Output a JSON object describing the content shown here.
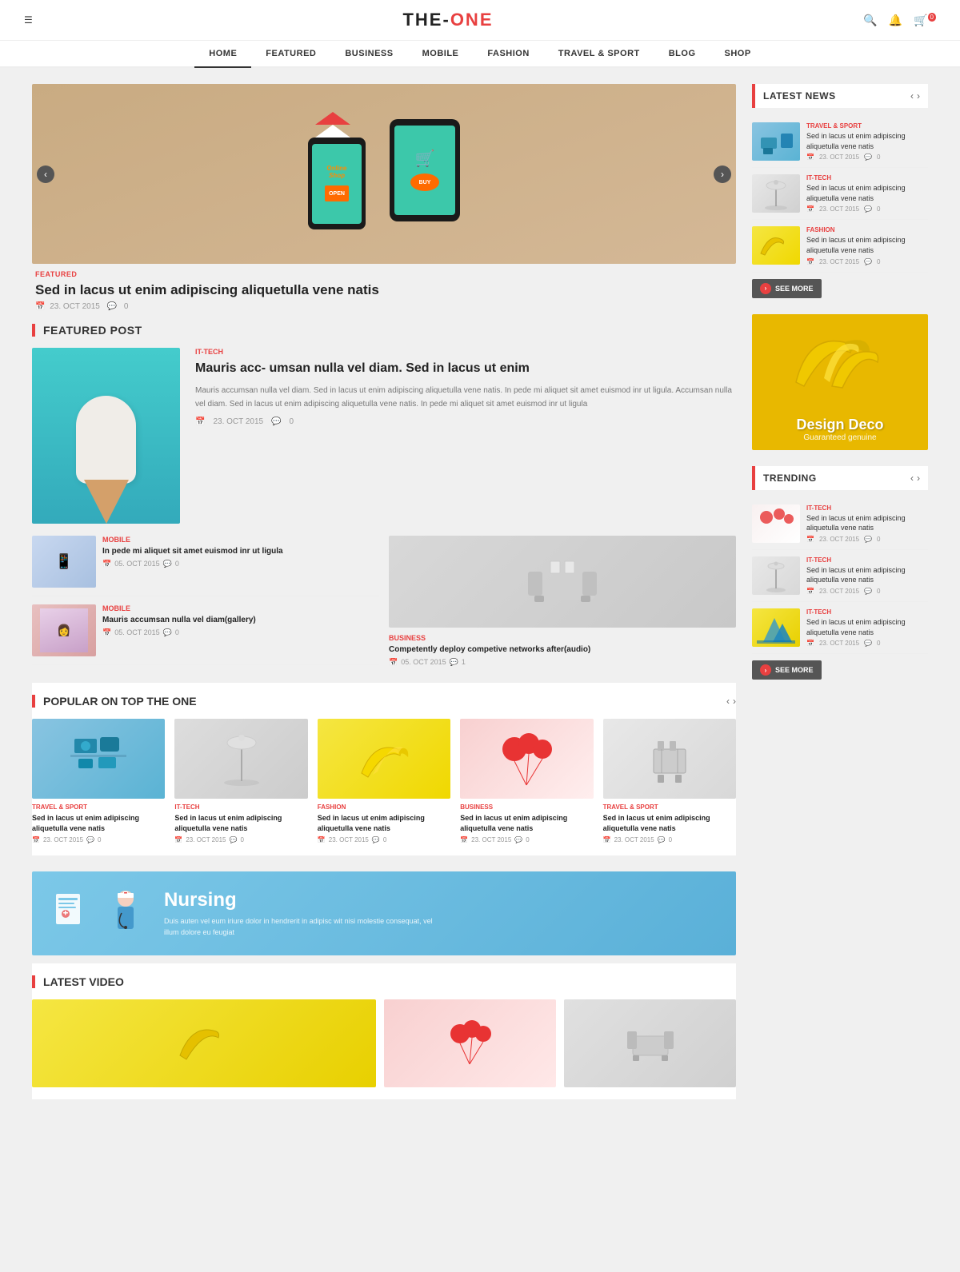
{
  "site": {
    "title_part1": "THE-",
    "title_part2": "ONE"
  },
  "header": {
    "menu_icon": "☰",
    "search_icon": "🔍",
    "bell_icon": "🔔",
    "cart_icon": "🛒",
    "cart_count": "0"
  },
  "nav": {
    "items": [
      {
        "label": "HOME",
        "active": true
      },
      {
        "label": "FEATURED",
        "active": false
      },
      {
        "label": "BUSINESS",
        "active": false
      },
      {
        "label": "MOBILE",
        "active": false
      },
      {
        "label": "FASHION",
        "active": false
      },
      {
        "label": "TRAVEL & SPORT",
        "active": false
      },
      {
        "label": "BLOG",
        "active": false
      },
      {
        "label": "SHOP",
        "active": false
      }
    ]
  },
  "hero": {
    "category": "FEATURED",
    "title": "Sed in lacus ut enim adipiscing aliquetulla vene natis",
    "date": "23. OCT 2015",
    "comments": "0"
  },
  "featured_section": {
    "heading": "FEATURED POST",
    "main_post": {
      "category": "IT-TECH",
      "title": "Mauris acc- umsan nulla vel diam. Sed in lacus ut enim",
      "excerpt": "Mauris accumsan nulla vel diam. Sed in lacus ut enim adipiscing aliquetulla vene natis. In pede mi aliquet sit amet euismod inr ut ligula. Accumsan nulla vel diam. Sed in lacus ut enim adipiscing aliquetulla vene natis. In pede mi aliquet sit amet euismod inr ut ligula",
      "date": "23. OCT 2015",
      "comments": "0"
    },
    "side_posts": [
      {
        "category": "MOBILE",
        "title": "In pede mi aliquet sit amet euismod inr ut ligula",
        "date": "05. OCT 2015",
        "comments": "0",
        "img_class": "img-mobile"
      },
      {
        "category": "MOBILE",
        "title": "Mauris accumsan nulla vel diam(gallery)",
        "date": "05. OCT 2015",
        "comments": "0",
        "img_class": "img-fashion"
      },
      {
        "category": "BUSINESS",
        "title": "Competently deploy competive networks after(audio)",
        "date": "05. OCT 2015",
        "comments": "1",
        "img_class": "img-sofa"
      }
    ]
  },
  "latest_news": {
    "heading": "LATEST NEWS",
    "items": [
      {
        "category": "TRAVEL & SPORT",
        "text": "Sed in lacus ut enim adipiscing aliquetulla vene natis",
        "date": "23. OCT 2015",
        "comments": "0",
        "img_class": "img-travel"
      },
      {
        "category": "IT-TECH",
        "text": "Sed in lacus ut enim adipiscing aliquetulla vene natis",
        "date": "23. OCT 2015",
        "comments": "0",
        "img_class": "img-ittech"
      },
      {
        "category": "FASHION",
        "text": "Sed in lacus ut enim adipiscing aliquetulla vene natis",
        "date": "23. OCT 2015",
        "comments": "0",
        "img_class": "img-fashion"
      }
    ],
    "see_more": "SEE MORE"
  },
  "ad_banner": {
    "title": "Design Deco",
    "subtitle": "Guaranteed genuine"
  },
  "trending": {
    "heading": "TRENDING",
    "items": [
      {
        "category": "IT-TECH",
        "text": "Sed in lacus ut enim adipiscing aliquetulla vene natis",
        "date": "23. OCT 2015",
        "comments": "0",
        "img_class": "img-balloon"
      },
      {
        "category": "IT-TECH",
        "text": "Sed in lacus ut enim adipiscing aliquetulla vene natis",
        "date": "23. OCT 2015",
        "comments": "0",
        "img_class": "img-ittech"
      },
      {
        "category": "IT-TECH",
        "text": "Sed in lacus ut enim adipiscing aliquetulla vene natis",
        "date": "23. OCT 2015",
        "comments": "0",
        "img_class": "img-banana"
      }
    ],
    "see_more": "SEE MORE"
  },
  "popular": {
    "heading": "POPULAR ON TOP THE ONE",
    "items": [
      {
        "category": "TRAVEL & SPORT",
        "title": "Sed in lacus ut enim adipiscing aliquetulla vene natis",
        "date": "23. OCT 2015",
        "comments": "0",
        "img_class": "img-travel"
      },
      {
        "category": "IT-TECH",
        "title": "Sed in lacus ut enim adipiscing aliquetulla vene natis",
        "date": "23. OCT 2015",
        "comments": "0",
        "img_class": "img-lamp"
      },
      {
        "category": "FASHION",
        "title": "Sed in lacus ut enim adipiscing aliquetulla vene natis",
        "date": "23. OCT 2015",
        "comments": "0",
        "img_class": "img-banana"
      },
      {
        "category": "BUSINESS",
        "title": "Sed in lacus ut enim adipiscing aliquetulla vene natis",
        "date": "23. OCT 2015",
        "comments": "0",
        "img_class": "img-balloon"
      },
      {
        "category": "TRAVEL & SPORT",
        "title": "Sed in lacus ut enim adipiscing aliquetulla vene natis",
        "date": "23. OCT 2015",
        "comments": "0",
        "img_class": "img-kitchen"
      }
    ]
  },
  "nursing_banner": {
    "title": "Nursing",
    "text": "Duis auten vel eum iriure dolor in hendrerit in adipisc wit nisi molestie consequat, vel illum dolore eu feugiat"
  },
  "latest_video": {
    "heading": "LATEST VIDEO"
  }
}
